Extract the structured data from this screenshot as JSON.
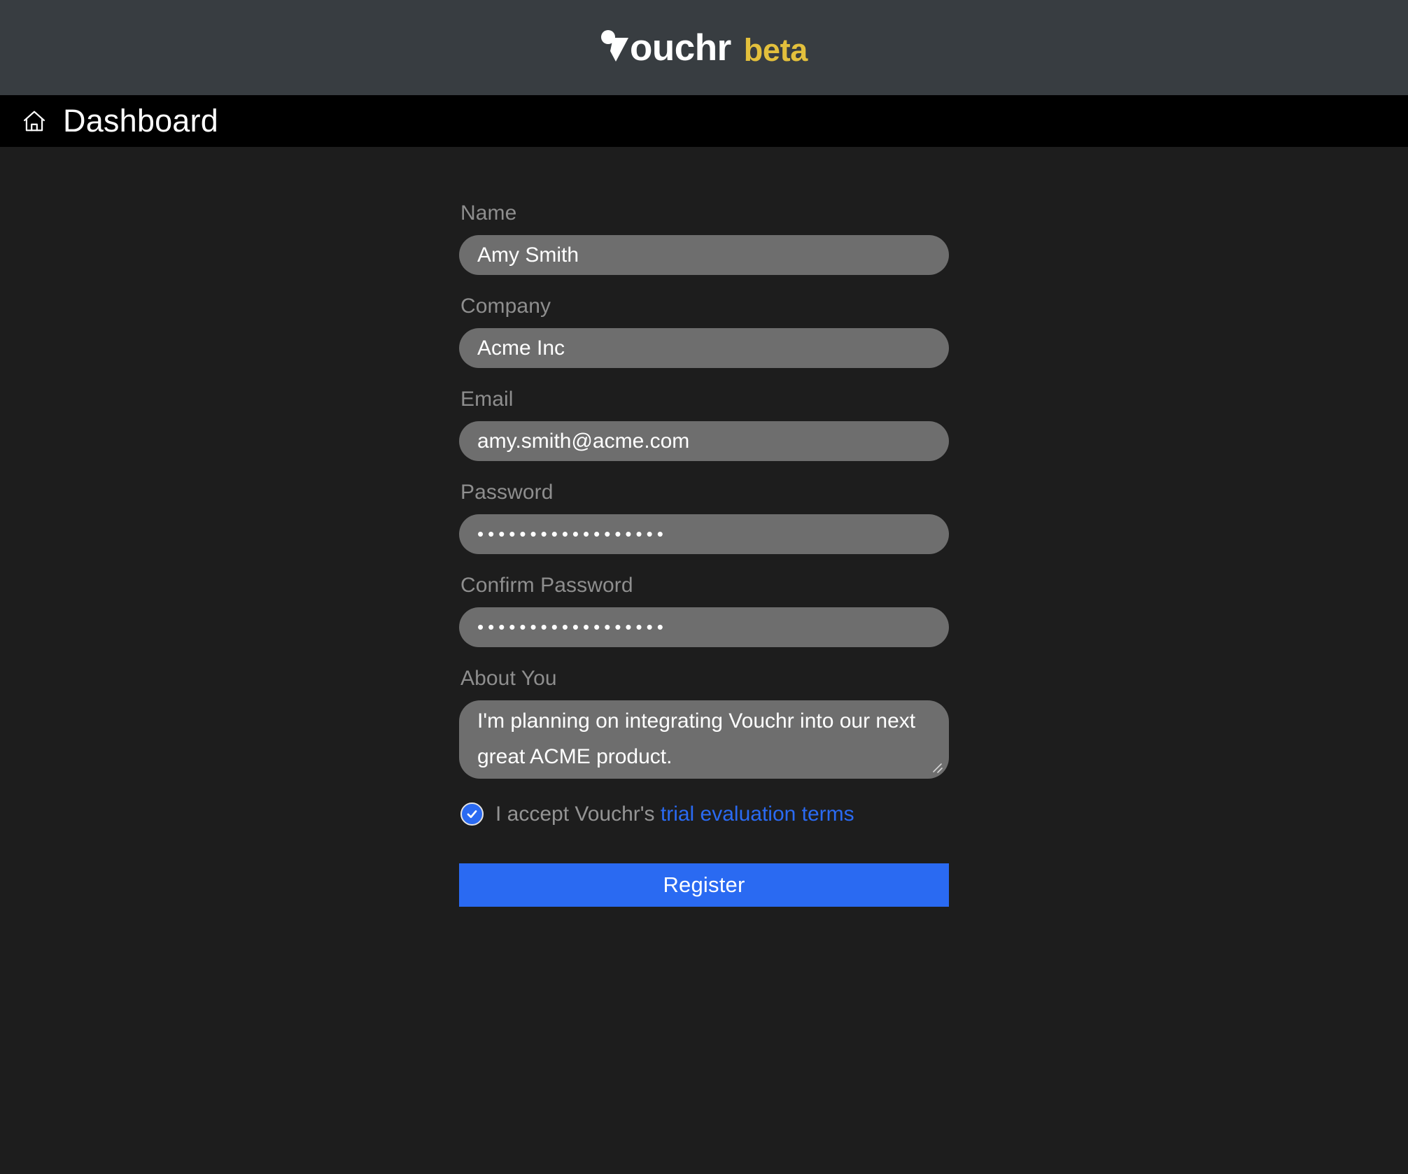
{
  "brand": {
    "name": "ouchr",
    "full_name": "Vouchr",
    "badge": "beta",
    "badge_color": "#e3c03c",
    "bar_color": "#383d41"
  },
  "nav": {
    "home_icon": "home-icon",
    "title": "Dashboard",
    "bar_color": "#000000"
  },
  "form": {
    "fields": [
      {
        "label": "Name",
        "value": "Amy Smith",
        "type": "text",
        "placeholder": "Name"
      },
      {
        "label": "Company",
        "value": "Acme Inc",
        "type": "text",
        "placeholder": "Company"
      },
      {
        "label": "Email",
        "value": "amy.smith@acme.com",
        "type": "email",
        "placeholder": "Email"
      },
      {
        "label": "Password",
        "value": "••••••••••••••••••",
        "type": "password",
        "placeholder": "Password"
      },
      {
        "label": "Confirm Password",
        "value": "••••••••••••••••••",
        "type": "password",
        "placeholder": "Confirm Password"
      }
    ],
    "about": {
      "label": "About You",
      "value": "I'm planning on integrating Vouchr into our next great ACME product.",
      "placeholder": "About You"
    },
    "consent": {
      "checked": true,
      "text": "I accept Vouchr's",
      "link_text": "trial evaluation terms",
      "link_color": "#2a6af2"
    },
    "submit": {
      "label": "Register",
      "color": "#2a6af2"
    },
    "input_fill": "#6e6e6e",
    "label_color": "#8e8e8e",
    "body_color": "#1d1d1d"
  }
}
